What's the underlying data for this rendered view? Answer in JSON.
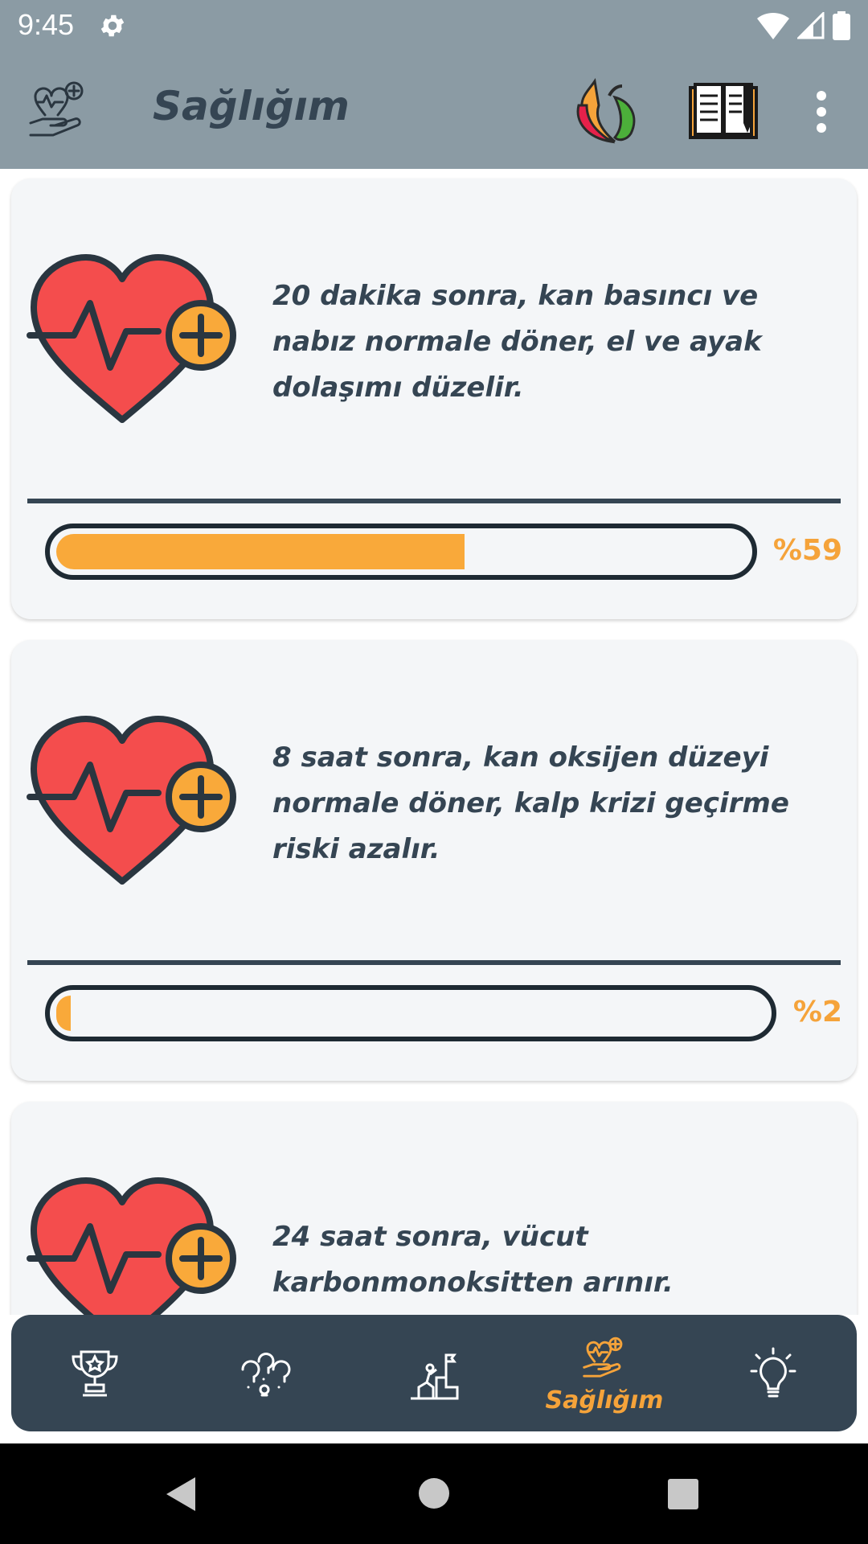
{
  "status_bar": {
    "time": "9:45"
  },
  "app_bar": {
    "title": "Sağlığım"
  },
  "cards": [
    {
      "text": "20 dakika sonra, kan basıncı ve nabız normale döner, el ve ayak dolaşımı düzelir.",
      "progress": 59,
      "progress_label": "%59"
    },
    {
      "text": "8 saat sonra, kan oksijen düzeyi normale döner, kalp krizi geçirme riski azalır.",
      "progress": 2,
      "progress_label": "%2"
    },
    {
      "text": "24 saat sonra, vücut karbonmonoksitten arınır."
    }
  ],
  "bottom_nav": {
    "active_label": "Sağlığım",
    "items": [
      "trophy-icon",
      "ideas-icon",
      "climb-goal-icon",
      "health-hand-icon",
      "lightbulb-icon"
    ]
  },
  "colors": {
    "bar": "#8b9ba4",
    "dark": "#354553",
    "accent": "#f9a93a",
    "card": "#f4f6f8"
  }
}
